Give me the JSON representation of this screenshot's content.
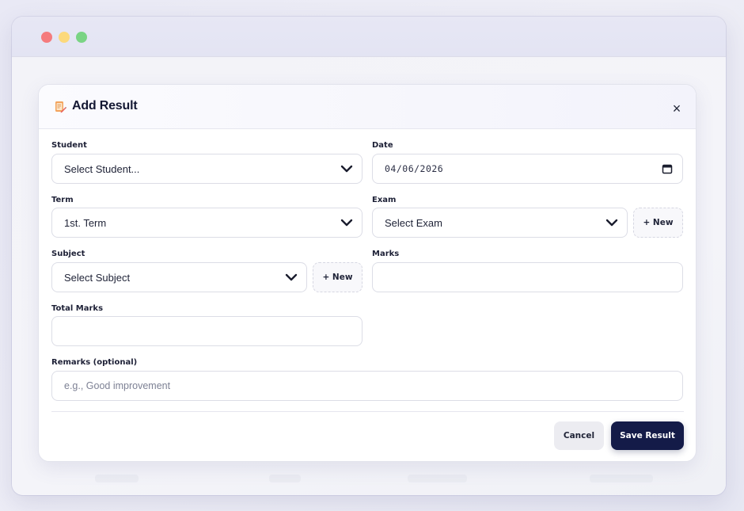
{
  "window": {
    "controls": [
      "close",
      "minimize",
      "maximize"
    ]
  },
  "modal": {
    "title": "Add Result",
    "title_icon": "memo-icon",
    "close_label": "×"
  },
  "form": {
    "student": {
      "label": "Student",
      "value": "Select Student..."
    },
    "date": {
      "label": "Date",
      "value": "04/06/2026"
    },
    "term": {
      "label": "Term",
      "value": "1st. Term"
    },
    "exam": {
      "label": "Exam",
      "value": "Select Exam",
      "new_label": "+ New"
    },
    "subject": {
      "label": "Subject",
      "value": "Select Subject",
      "new_label": "+ New"
    },
    "marks": {
      "label": "Marks",
      "value": ""
    },
    "total_marks": {
      "label": "Total Marks",
      "value": ""
    },
    "remarks": {
      "label": "Remarks (optional)",
      "placeholder": "e.g., Good improvement",
      "value": ""
    }
  },
  "actions": {
    "cancel_label": "Cancel",
    "save_label": "Save Result"
  },
  "colors": {
    "primary": "#141b48",
    "traffic_red": "#f57b7d",
    "traffic_yellow": "#fcd97b",
    "traffic_green": "#7ad484"
  }
}
